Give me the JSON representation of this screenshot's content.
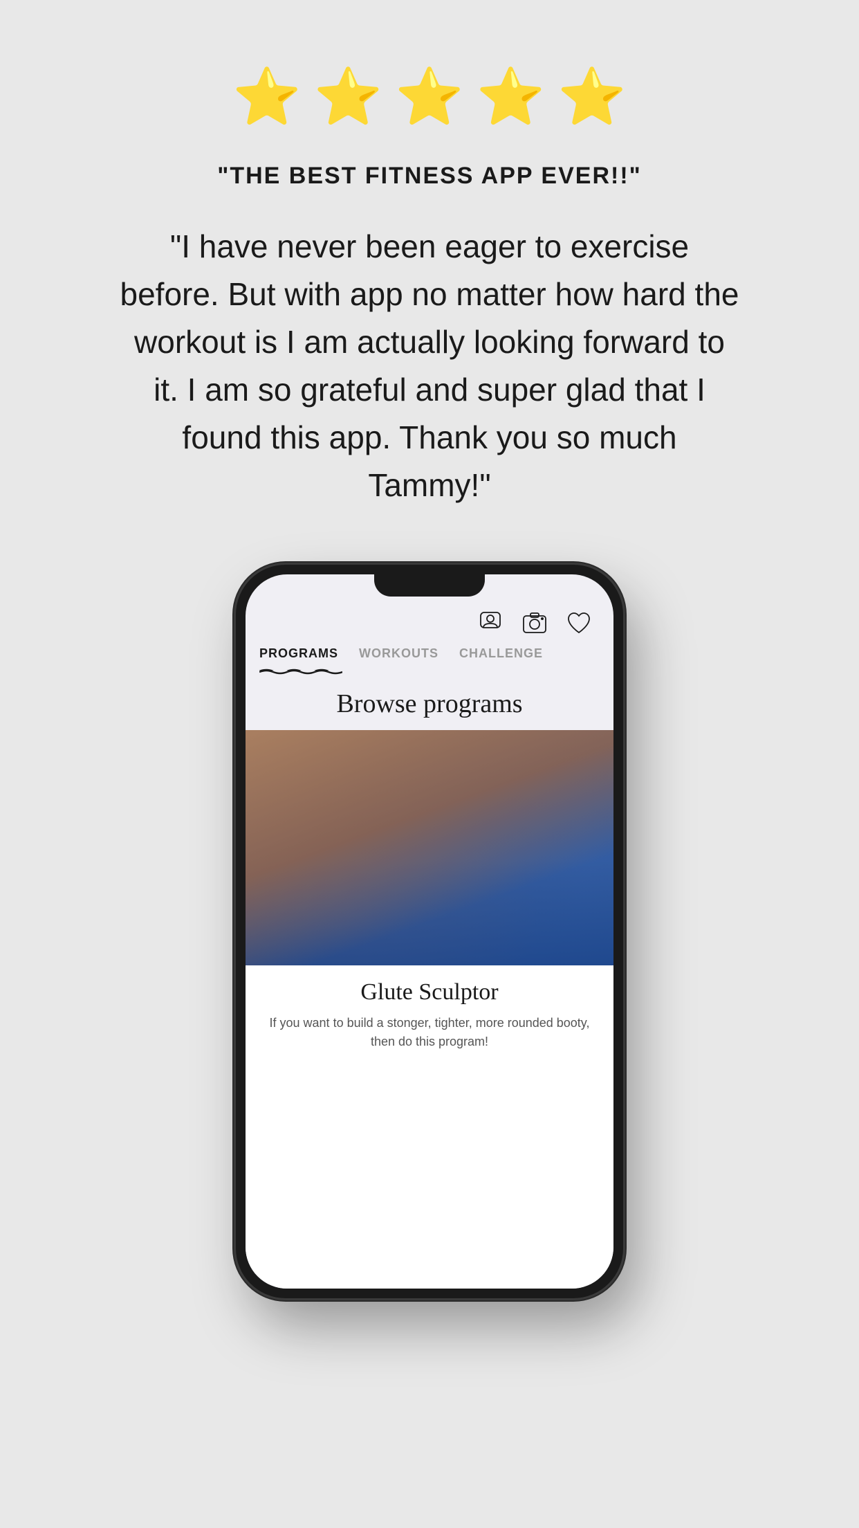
{
  "background_color": "#e8e8e8",
  "stars": {
    "count": 5,
    "emoji": "⭐"
  },
  "review": {
    "title": "\"THE BEST FITNESS APP EVER!!\"",
    "body": "\"I have never been eager to exercise before. But with app no matter how hard the workout is I am actually looking forward to it. I am so grateful and super glad that I found this app. Thank you so much Tammy!\""
  },
  "phone": {
    "nav_tabs": [
      {
        "label": "PROGRAMS",
        "active": true
      },
      {
        "label": "WORKOUTS",
        "active": false
      },
      {
        "label": "CHALLENGE",
        "active": false
      }
    ],
    "icons": [
      {
        "name": "profile-icon"
      },
      {
        "name": "camera-icon"
      },
      {
        "name": "heart-icon"
      }
    ],
    "browse_title": "Browse programs",
    "program": {
      "name": "Glute Sculptor",
      "description": "If you want to build a stonger, tighter, more rounded booty, then do this program!"
    }
  }
}
